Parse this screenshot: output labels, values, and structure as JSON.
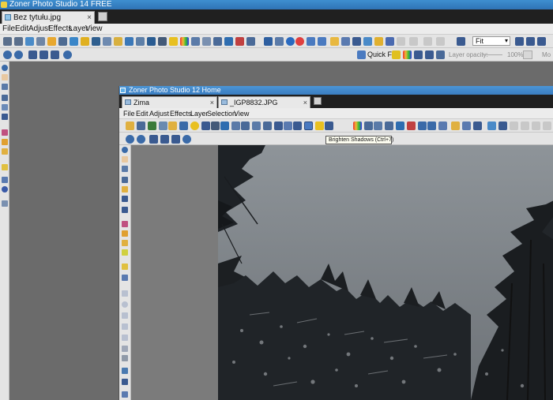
{
  "app": {
    "title": "Zoner Photo Studio 14 FREE",
    "tab_label": "Bez tytułu.jpg",
    "tab_close": "×",
    "menu": [
      "File",
      "Edit",
      "Adjust",
      "Effects",
      "Layer",
      "View"
    ],
    "zoom_select": "Fit",
    "quick_fix_label": "Quick Fix",
    "layer_opacity_label": "Layer opacity:",
    "layer_opacity_value": "100%",
    "mode_label": "Mo"
  },
  "inner": {
    "title": "Zoner Photo Studio 12 Home",
    "tabs": [
      {
        "label": "Zima",
        "close": "×"
      },
      {
        "label": "_IGP8832.JPG",
        "close": "×"
      }
    ],
    "menu": [
      "File",
      "Edit",
      "Adjust",
      "Effects",
      "Layer",
      "Selection",
      "View"
    ],
    "tooltip": "Brighten Shadows (Ctrl+7)"
  }
}
